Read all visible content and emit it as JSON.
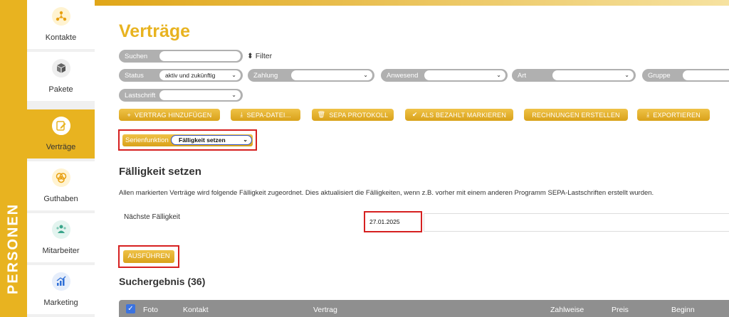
{
  "side_band": {
    "label": "PERSONEN"
  },
  "sidebar": {
    "items": [
      {
        "label": "Kontakte",
        "icon": "people-network-icon",
        "active": false
      },
      {
        "label": "Pakete",
        "icon": "package-boxes-icon",
        "active": false
      },
      {
        "label": "Verträge",
        "icon": "contract-edit-icon",
        "active": true
      },
      {
        "label": "Guthaben",
        "icon": "coins-icon",
        "active": false
      },
      {
        "label": "Mitarbeiter",
        "icon": "staff-icon",
        "active": false
      },
      {
        "label": "Marketing",
        "icon": "chart-growth-icon",
        "active": false
      }
    ]
  },
  "page": {
    "title": "Verträge"
  },
  "filters": {
    "search_label": "Suchen",
    "search_value": "",
    "filter_toggle": "Filter",
    "status_label": "Status",
    "status_value": "aktiv und zukünftig",
    "zahlung_label": "Zahlung",
    "zahlung_value": "",
    "anwesend_label": "Anwesend",
    "anwesend_value": "",
    "art_label": "Art",
    "art_value": "",
    "gruppe_label": "Gruppe",
    "gruppe_value": "",
    "lastschrift_label": "Lastschrift",
    "lastschrift_value": ""
  },
  "actions": {
    "add": "VERTRAG HINZUFÜGEN",
    "sepa_file": "SEPA-DATEI...",
    "sepa_protocol": "SEPA PROTOKOLL",
    "mark_paid": "ALS BEZAHLT MARKIEREN",
    "invoices": "RECHNUNGEN ERSTELLEN",
    "export": "EXPORTIEREN"
  },
  "serien": {
    "label": "Serienfunktion",
    "value": "Fälligkeit setzen"
  },
  "section": {
    "heading": "Fälligkeit setzen",
    "description": "Allen markierten Verträge wird folgende Fälligkeit zugeordnet. Dies aktualisiert die Fälligkeiten, wenn z.B. vorher mit einem anderen Programm SEPA-Lastschriften erstellt wurden.",
    "next_due_label": "Nächste Fälligkeit",
    "next_due_value": "27.01.2025",
    "run_button": "AUSFÜHREN"
  },
  "results": {
    "heading": "Suchergebnis (36)",
    "columns": [
      "Foto",
      "Kontakt",
      "Vertrag",
      "Zahlweise",
      "Preis",
      "Beginn"
    ]
  },
  "colors": {
    "accent": "#e8b320",
    "highlight": "#d62020",
    "header_grey": "#8f8f8f"
  }
}
